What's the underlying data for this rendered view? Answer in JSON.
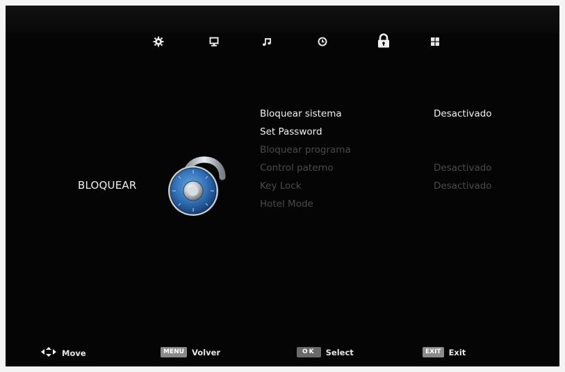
{
  "tabs": [
    {
      "name": "tab-settings",
      "icon": "gear-icon"
    },
    {
      "name": "tab-picture",
      "icon": "monitor-icon"
    },
    {
      "name": "tab-sound",
      "icon": "music-note-icon"
    },
    {
      "name": "tab-time",
      "icon": "clock-icon"
    },
    {
      "name": "tab-lock",
      "icon": "padlock-icon",
      "selected": true
    },
    {
      "name": "tab-apps",
      "icon": "grid-icon"
    }
  ],
  "category": {
    "label": "BLOQUEAR",
    "icon": "combination-lock-icon"
  },
  "menu": {
    "items": [
      {
        "label": "Bloquear sistema",
        "value": "Desactivado",
        "enabled": true
      },
      {
        "label": "Set Password",
        "value": "",
        "enabled": true
      },
      {
        "label": "Bloquear programa",
        "value": "",
        "enabled": false
      },
      {
        "label": "Control paterno",
        "value": "Desactivado",
        "enabled": false
      },
      {
        "label": "Key Lock",
        "value": "Desactivado",
        "enabled": false
      },
      {
        "label": "Hotel Mode",
        "value": "",
        "enabled": false
      }
    ]
  },
  "footer": {
    "move_label": "Move",
    "menu_key": "MENU",
    "menu_label": "Volver",
    "ok_key": "OK",
    "ok_label": "Select",
    "exit_key": "EXIT",
    "exit_label": "Exit"
  },
  "colors": {
    "background": "#050505",
    "active_text": "#f2f2f2",
    "disabled_text": "#4a4a4a",
    "lock_blue": "#2f6fb5"
  }
}
